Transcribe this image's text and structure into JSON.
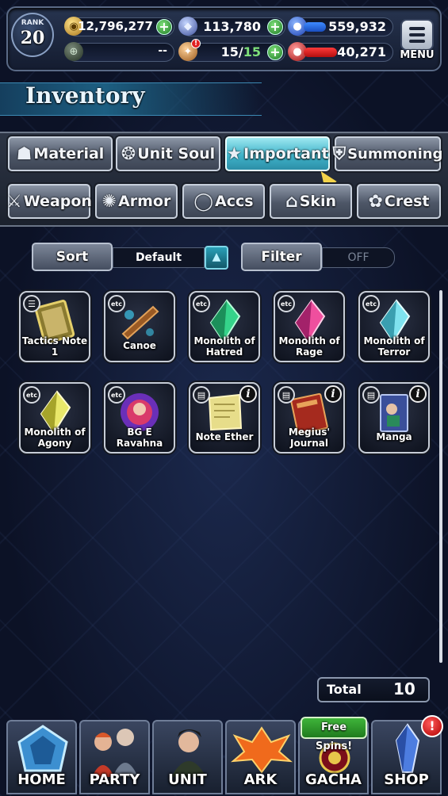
{
  "status": {
    "rank_label": "RANK",
    "rank_value": "20",
    "gold": "12,796,277",
    "crystals": "113,780",
    "blue_orb": "559,932",
    "slot_one": "--",
    "stamina_current": "15",
    "stamina_separator": "/",
    "stamina_max": "15",
    "red_orb": "40,271",
    "menu_label": "MENU"
  },
  "header": {
    "title": "Inventory"
  },
  "tabs_row1": [
    {
      "label": "Material",
      "icon": "sack-icon"
    },
    {
      "label": "Unit Soul",
      "icon": "flame-icon"
    },
    {
      "label": "Important",
      "icon": "star-icon"
    },
    {
      "label": "Summoning",
      "icon": "shield-icon"
    }
  ],
  "tabs_row2": [
    {
      "label": "Weapon",
      "icon": "sword-icon"
    },
    {
      "label": "Armor",
      "icon": "armor-icon"
    },
    {
      "label": "Accs",
      "icon": "ring-icon"
    },
    {
      "label": "Skin",
      "icon": "hanger-icon"
    },
    {
      "label": "Crest",
      "icon": "crest-icon"
    }
  ],
  "active_tab": "Important",
  "controls": {
    "sort_label": "Sort",
    "sort_value": "Default",
    "filter_label": "Filter",
    "filter_value": "OFF"
  },
  "items": [
    {
      "name_line1": "Tactics Note",
      "name_line2": "1",
      "tag": "note"
    },
    {
      "name_line1": "Canoe",
      "name_line2": "",
      "tag": "etc"
    },
    {
      "name_line1": "Monolith of",
      "name_line2": "Hatred",
      "tag": "etc"
    },
    {
      "name_line1": "Monolith of",
      "name_line2": "Rage",
      "tag": "etc"
    },
    {
      "name_line1": "Monolith of",
      "name_line2": "Terror",
      "tag": "etc"
    },
    {
      "name_line1": "Monolith of",
      "name_line2": "Agony",
      "tag": "etc"
    },
    {
      "name_line1": "BG E",
      "name_line2": "Ravahna",
      "tag": "etc"
    },
    {
      "name_line1": "Note Ether",
      "name_line2": "",
      "tag": "note"
    },
    {
      "name_line1": "Megius'",
      "name_line2": "Journal",
      "tag": "note"
    },
    {
      "name_line1": "Manga",
      "name_line2": "",
      "tag": "note"
    }
  ],
  "item_tag_text": "etc",
  "info_glyph": "i",
  "total": {
    "label": "Total",
    "value": "10"
  },
  "nav": [
    {
      "label": "HOME"
    },
    {
      "label": "PARTY"
    },
    {
      "label": "UNIT"
    },
    {
      "label": "ARK"
    },
    {
      "label": "GACHA"
    },
    {
      "label": "SHOP"
    }
  ],
  "free_spins": "Free Spins!",
  "shop_alert": "!",
  "colors": {
    "active_tab": "#3fb3c9",
    "stamina_max": "#7ee07a",
    "gold_plus": "#2f9a34",
    "blue_bar": "#1f6fe0",
    "red_bar": "#d11b1b"
  }
}
